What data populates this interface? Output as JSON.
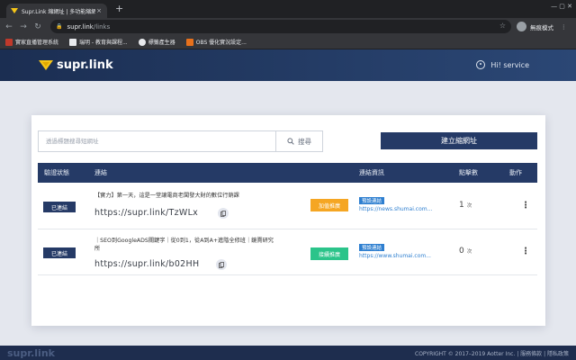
{
  "browser": {
    "tab_title": "Supr.Link 縮網址 | 多功能縮網址",
    "tab_close": "×",
    "new_tab": "+",
    "window_controls": "—  ▢  ✕",
    "url_host": "supr.link",
    "url_path": "/links",
    "profile_label": "無痕模式",
    "bookmarks": [
      {
        "label": "實家直播管理系統",
        "color": "#e8eaed"
      },
      {
        "label": "瑞明 - 教育與課程...",
        "color": "#e8eaed"
      },
      {
        "label": "標籤產生器",
        "color": "#e8eaed"
      },
      {
        "label": "OBS 優化實況設定...",
        "color": "#e8711c"
      }
    ]
  },
  "header": {
    "brand": "supr.link",
    "user_label": "Hi! service"
  },
  "search": {
    "placeholder": "透過標題搜尋短網址",
    "button_label": "搜尋"
  },
  "create_button": "建立縮網址",
  "table": {
    "headers": [
      "驗證狀態",
      "連結",
      "連結資訊",
      "點擊數",
      "動作"
    ],
    "rows": [
      {
        "status": "已連結",
        "title": "【實力】第一天，這是一堂讓電商老闆發大財的數位行銷課",
        "short_url": "https://supr.link/TzWLx",
        "action_label": "加值推廣",
        "action_color": "#f5a623",
        "tag": "預設連結",
        "destination": "https://news.shumai.com...",
        "clicks": "1",
        "unit": "次"
      },
      {
        "status": "已連結",
        "title": "｜SEO到GoogleADS關鍵字｜從0到1，從A到A+進階全修班｜鏡賣研究所",
        "short_url": "https://supr.link/b02HH",
        "action_label": "接續推廣",
        "action_color": "#2bc48a",
        "tag": "預設連結",
        "destination": "https://www.shumai.com...",
        "clicks": "0",
        "unit": "次"
      }
    ]
  },
  "footer": {
    "brand": "supr.link",
    "copyright": "COPYRIGHT © 2017–2019 Aotter Inc. | 服務條款 | 隱私政策"
  }
}
